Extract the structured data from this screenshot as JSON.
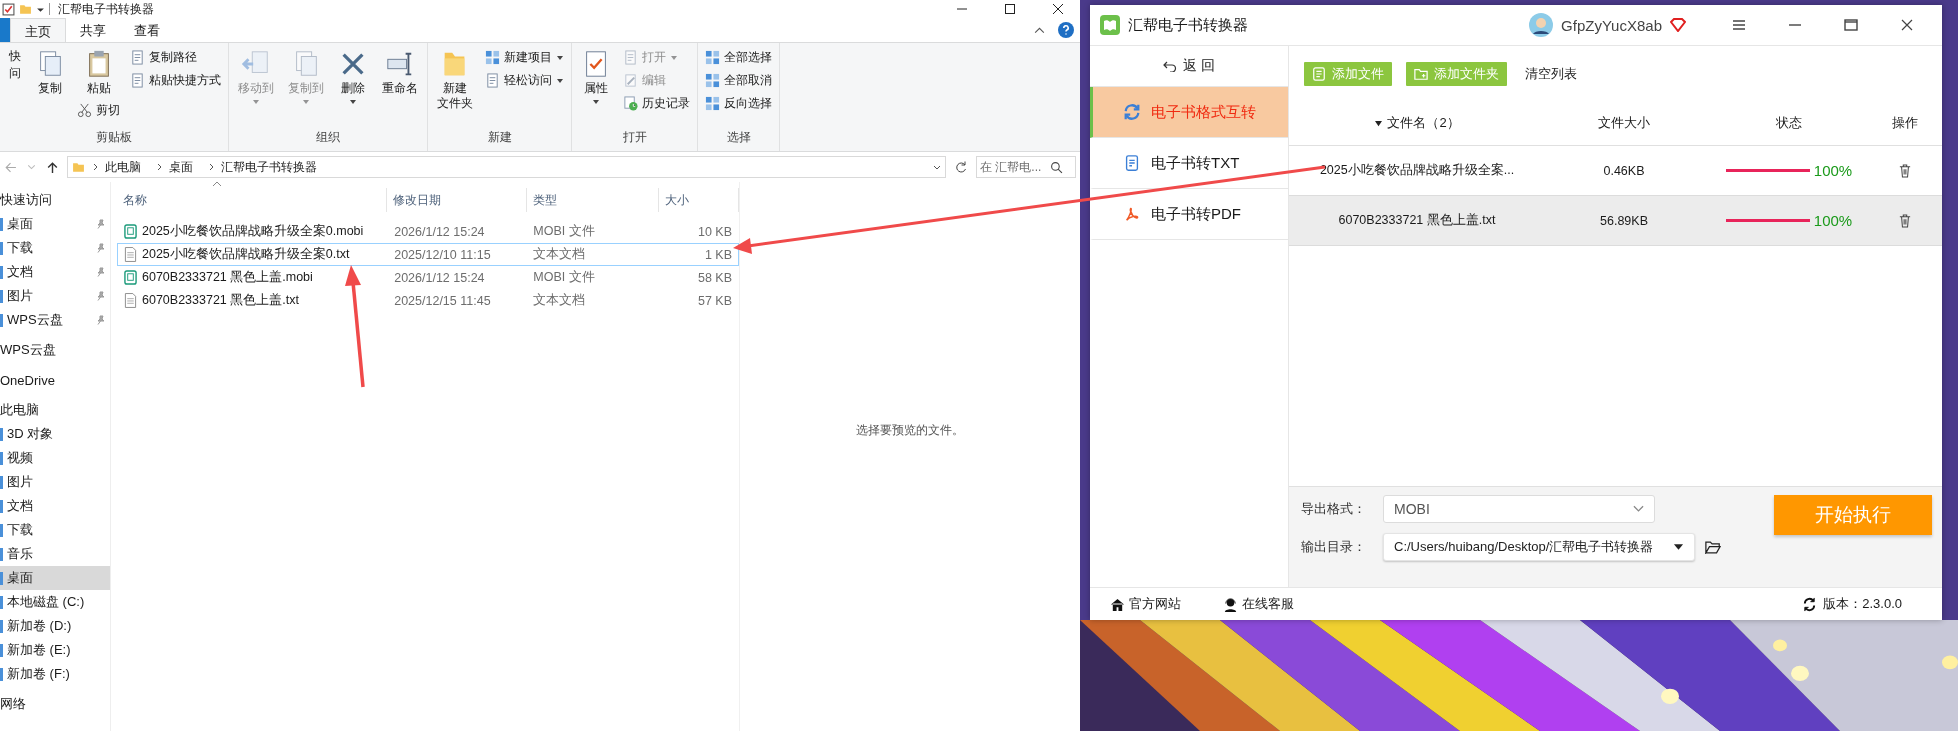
{
  "explorer": {
    "title": "汇帮电子书转换器",
    "tabs": [
      {
        "label": "主页",
        "selected": true
      },
      {
        "label": "共享",
        "selected": false
      },
      {
        "label": "查看",
        "selected": false
      }
    ],
    "ribbon": [
      {
        "label": "剪贴板",
        "columns": [
          [
            {
              "kind": "partial",
              "lines": [
                "快",
                "问"
              ]
            }
          ],
          [
            {
              "label": "复制",
              "kind": "large",
              "dropdown": false,
              "disabled": false
            }
          ],
          [
            {
              "label": "粘贴",
              "kind": "large",
              "dropdown": false,
              "disabled": false
            },
            {
              "label": "剪切",
              "kind": "small",
              "dropdown": false,
              "disabled": false
            }
          ],
          [
            {
              "label": "复制路径",
              "kind": "small",
              "dropdown": false,
              "disabled": false
            },
            {
              "label": "粘贴快捷方式",
              "kind": "small",
              "dropdown": false,
              "disabled": false
            }
          ]
        ]
      },
      {
        "label": "组织",
        "columns": [
          [
            {
              "label": "移动到",
              "kind": "large",
              "dropdown": true,
              "disabled": true
            }
          ],
          [
            {
              "label": "复制到",
              "kind": "large",
              "dropdown": true,
              "disabled": true
            }
          ],
          [
            {
              "label": "删除",
              "kind": "large",
              "dropdown": true,
              "disabled": false
            }
          ],
          [
            {
              "label": "重命名",
              "kind": "large",
              "dropdown": false,
              "disabled": false
            }
          ]
        ]
      },
      {
        "label": "新建",
        "columns": [
          [
            {
              "label": "新建文件夹",
              "kind": "large",
              "dropdown": false,
              "disabled": false
            }
          ],
          [
            {
              "label": "新建项目",
              "kind": "small",
              "dropdown": true,
              "disabled": false
            },
            {
              "label": "轻松访问",
              "kind": "small",
              "dropdown": true,
              "disabled": false
            }
          ]
        ]
      },
      {
        "label": "打开",
        "columns": [
          [
            {
              "label": "属性",
              "kind": "large",
              "dropdown": true,
              "disabled": false
            }
          ],
          [
            {
              "label": "打开",
              "kind": "small",
              "dropdown": true,
              "disabled": true
            },
            {
              "label": "编辑",
              "kind": "small",
              "dropdown": false,
              "disabled": true
            },
            {
              "label": "历史记录",
              "kind": "small",
              "dropdown": false,
              "disabled": false
            }
          ]
        ]
      },
      {
        "label": "选择",
        "columns": [
          [
            {
              "label": "全部选择",
              "kind": "small",
              "dropdown": false,
              "disabled": false
            },
            {
              "label": "全部取消",
              "kind": "small",
              "dropdown": false,
              "disabled": false
            },
            {
              "label": "反向选择",
              "kind": "small",
              "dropdown": false,
              "disabled": false
            }
          ]
        ]
      }
    ],
    "path": [
      "此电脑",
      "桌面",
      "汇帮电子书转换器"
    ],
    "search_placeholder": "在 汇帮电...",
    "nav": [
      {
        "label": "快速访问",
        "kind": "header",
        "pinned": false,
        "selected": false
      },
      {
        "label": "桌面",
        "kind": "item",
        "pinned": true,
        "selected": false
      },
      {
        "label": "下载",
        "kind": "item",
        "pinned": true,
        "selected": false
      },
      {
        "label": "文档",
        "kind": "item",
        "pinned": true,
        "selected": false
      },
      {
        "label": "图片",
        "kind": "item",
        "pinned": true,
        "selected": false
      },
      {
        "label": "WPS云盘",
        "kind": "item",
        "pinned": true,
        "selected": false
      },
      {
        "label": "WPS云盘",
        "kind": "header",
        "pinned": false,
        "selected": false
      },
      {
        "label": "OneDrive",
        "kind": "header",
        "pinned": false,
        "selected": false
      },
      {
        "label": "此电脑",
        "kind": "header",
        "pinned": false,
        "selected": false
      },
      {
        "label": "3D 对象",
        "kind": "item",
        "pinned": false,
        "selected": false
      },
      {
        "label": "视频",
        "kind": "item",
        "pinned": false,
        "selected": false
      },
      {
        "label": "图片",
        "kind": "item",
        "pinned": false,
        "selected": false
      },
      {
        "label": "文档",
        "kind": "item",
        "pinned": false,
        "selected": false
      },
      {
        "label": "下载",
        "kind": "item",
        "pinned": false,
        "selected": false
      },
      {
        "label": "音乐",
        "kind": "item",
        "pinned": false,
        "selected": false
      },
      {
        "label": "桌面",
        "kind": "item",
        "pinned": false,
        "selected": true
      },
      {
        "label": "本地磁盘 (C:)",
        "kind": "item",
        "pinned": false,
        "selected": false
      },
      {
        "label": "新加卷 (D:)",
        "kind": "item",
        "pinned": false,
        "selected": false
      },
      {
        "label": "新加卷 (E:)",
        "kind": "item",
        "pinned": false,
        "selected": false
      },
      {
        "label": "新加卷 (F:)",
        "kind": "item",
        "pinned": false,
        "selected": false
      },
      {
        "label": "网络",
        "kind": "header",
        "pinned": false,
        "selected": false
      }
    ],
    "columns": [
      "名称",
      "修改日期",
      "类型",
      "大小"
    ],
    "files": [
      {
        "name": "2025小吃餐饮品牌战略升级全案0.mobi",
        "modified": "2026/1/12 15:24",
        "type": "MOBI 文件",
        "size": "10 KB",
        "kind": "mobi",
        "selected": false
      },
      {
        "name": "2025小吃餐饮品牌战略升级全案0.txt",
        "modified": "2025/12/10 11:15",
        "type": "文本文档",
        "size": "1 KB",
        "kind": "txt",
        "selected": true
      },
      {
        "name": "6070B2333721 黑色上盖.mobi",
        "modified": "2026/1/12 15:24",
        "type": "MOBI 文件",
        "size": "58 KB",
        "kind": "mobi",
        "selected": false
      },
      {
        "name": "6070B2333721 黑色上盖.txt",
        "modified": "2025/12/15 11:45",
        "type": "文本文档",
        "size": "57 KB",
        "kind": "txt",
        "selected": false
      }
    ],
    "preview_text": "选择要预览的文件。"
  },
  "converter": {
    "title": "汇帮电子书转换器",
    "user": "GfpZyYucX8ab",
    "back": "返 回",
    "modes": [
      {
        "label": "电子书格式互转",
        "selected": true
      },
      {
        "label": "电子书转TXT",
        "selected": false
      },
      {
        "label": "电子书转PDF",
        "selected": false
      }
    ],
    "actions": [
      {
        "label": "添加文件",
        "kind": "file"
      },
      {
        "label": "添加文件夹",
        "kind": "folder"
      },
      {
        "label": "清空列表",
        "kind": "text"
      }
    ],
    "columns": [
      "文件名（2）",
      "文件大小",
      "状态",
      "操作"
    ],
    "rows": [
      {
        "name": "2025小吃餐饮品牌战略升级全案...",
        "size": "0.46KB",
        "level": 1,
        "reading": "100%",
        "selected": false
      },
      {
        "name": "6070B2333721 黑色上盖.txt",
        "size": "56.89KB",
        "level": 1,
        "reading": "100%",
        "selected": true
      }
    ],
    "format_label": "导出格式：",
    "format": "MOBI",
    "dir_label": "输出目录：",
    "dir": "C:/Users/huibang/Desktop/汇帮电子书转换器",
    "start": "开始执行",
    "footer": [
      "官方网站",
      "在线客服"
    ],
    "version": "版本：2.3.0.0"
  }
}
